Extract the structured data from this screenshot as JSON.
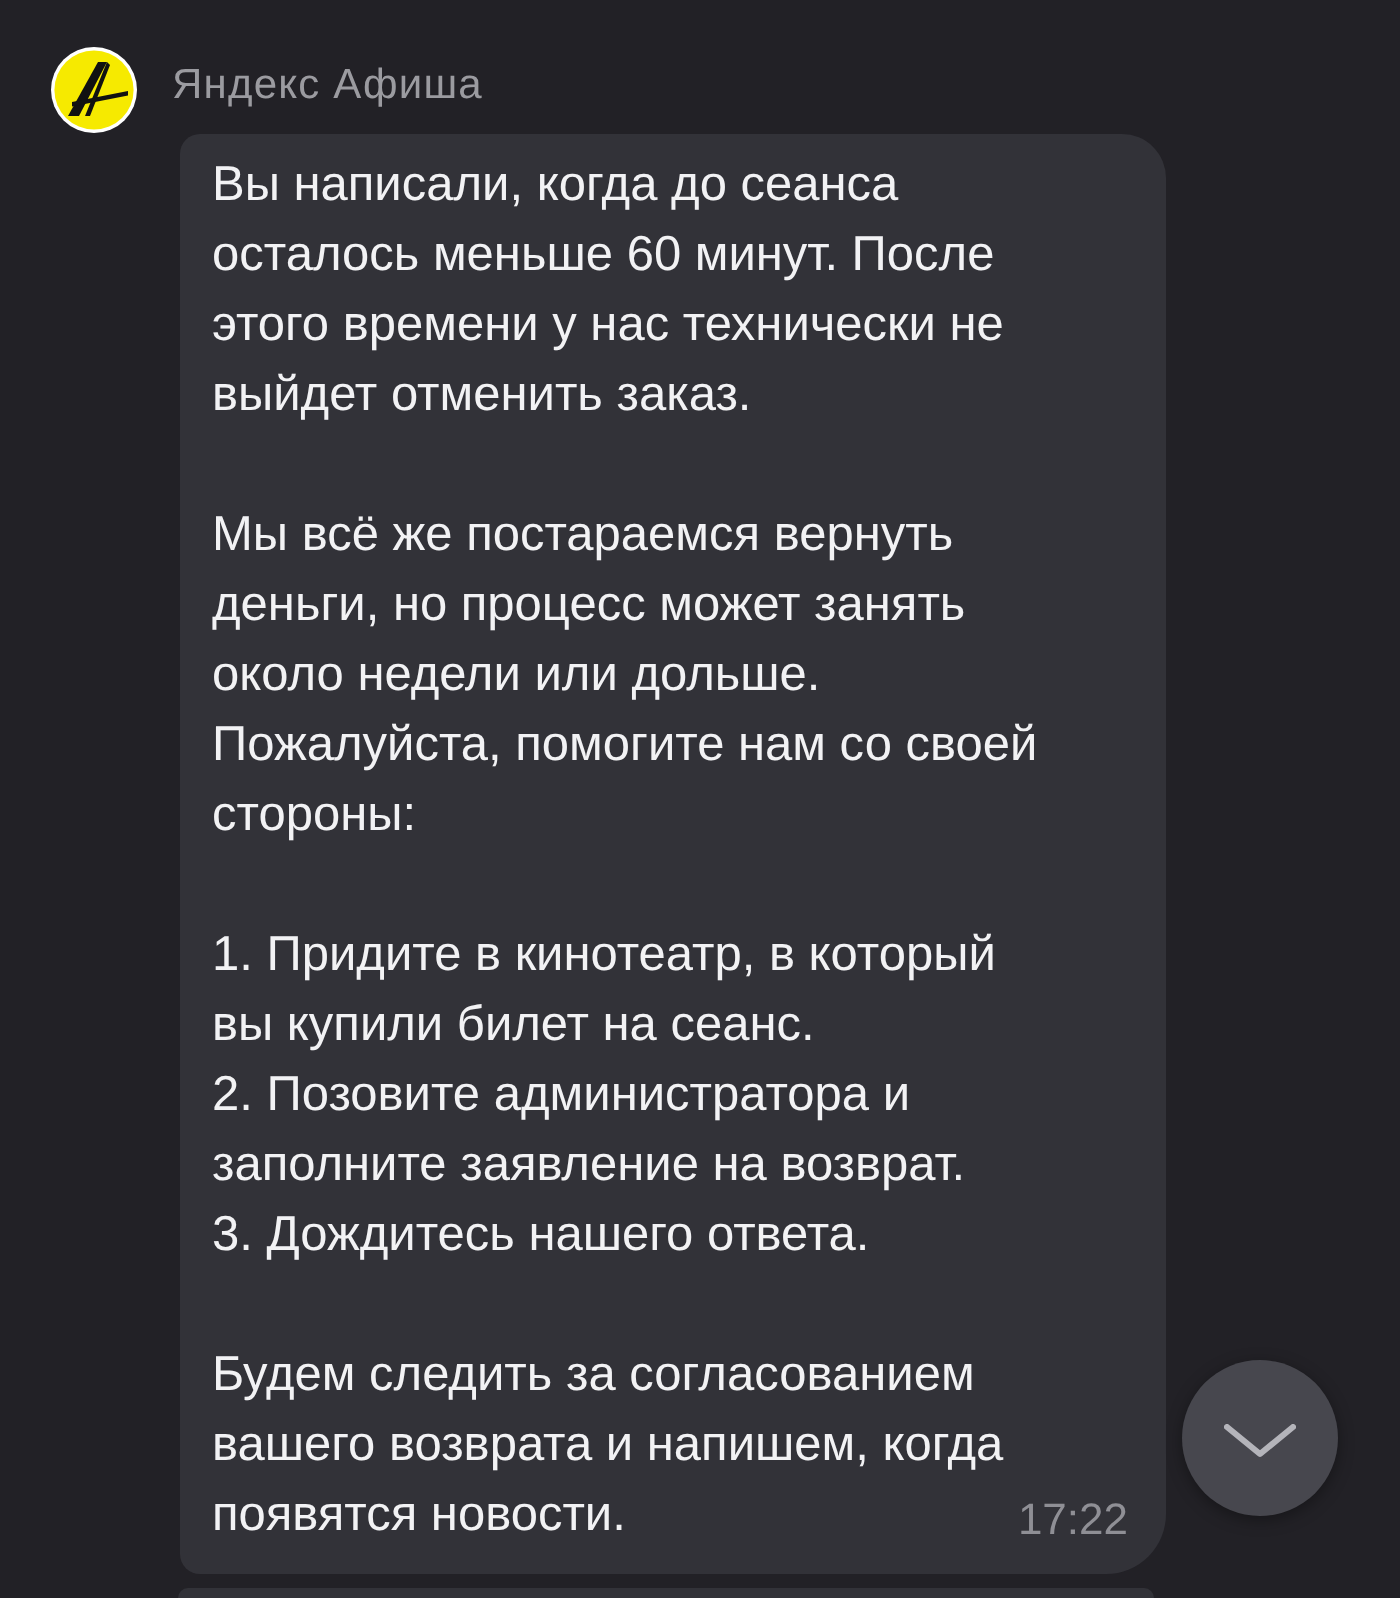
{
  "chat": {
    "sender": {
      "name": "Яндекс Афиша"
    },
    "message": {
      "blocks": [
        {
          "kind": "paragraph",
          "lines": [
            "Вы написали, когда до сеанса",
            "осталось меньше 60 минут. После",
            "этого времени у нас технически не",
            "выйдет отменить заказ."
          ]
        },
        {
          "kind": "paragraph",
          "lines": [
            "Мы всё же постараемся вернуть",
            "деньги, но процесс может занять",
            "около недели или дольше.",
            "Пожалуйста, помогите нам со своей",
            "стороны:"
          ]
        },
        {
          "kind": "list",
          "items": [
            [
              "1. Придите в кинотеатр, в который",
              "вы купили билет на сеанс."
            ],
            [
              "2. Позовите администратора и",
              "заполните заявление на возврат."
            ],
            [
              "3. Дождитесь нашего ответа."
            ]
          ]
        },
        {
          "kind": "paragraph",
          "lines": [
            "Будем следить за согласованием",
            "вашего возврата и напишем, когда",
            "появятся новости."
          ]
        }
      ],
      "time": "17:22"
    }
  }
}
